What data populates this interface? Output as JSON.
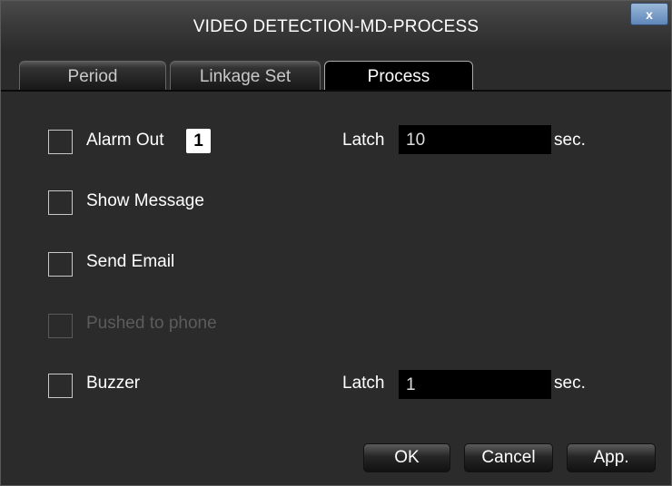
{
  "window": {
    "title": "VIDEO DETECTION-MD-PROCESS",
    "close_glyph": "x"
  },
  "tabs": [
    {
      "label": "Period",
      "active": false
    },
    {
      "label": "Linkage Set",
      "active": false
    },
    {
      "label": "Process",
      "active": true
    }
  ],
  "options": {
    "alarm_out": {
      "label": "Alarm Out",
      "checked": false,
      "channel": "1",
      "latch_label": "Latch",
      "latch_value": "10",
      "unit": "sec."
    },
    "show_message": {
      "label": "Show Message",
      "checked": false
    },
    "send_email": {
      "label": "Send Email",
      "checked": false
    },
    "pushed_to_phone": {
      "label": "Pushed to phone",
      "checked": false,
      "disabled": true
    },
    "buzzer": {
      "label": "Buzzer",
      "checked": false,
      "latch_label": "Latch",
      "latch_value": "1",
      "unit": "sec."
    }
  },
  "buttons": {
    "ok": "OK",
    "cancel": "Cancel",
    "apply": "App."
  }
}
